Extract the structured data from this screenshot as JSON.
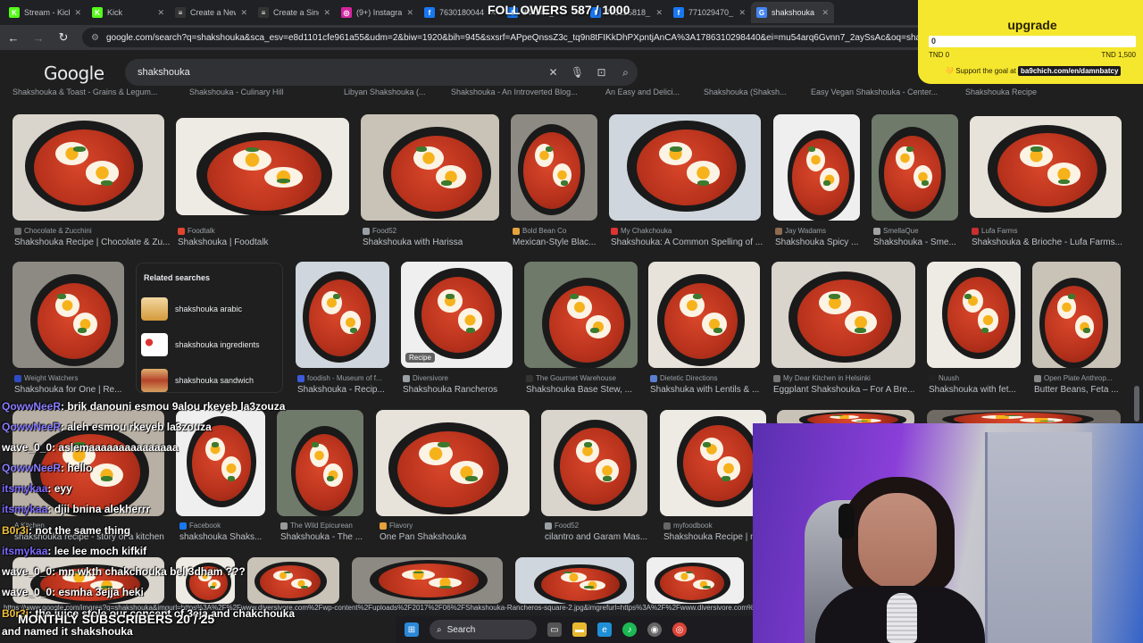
{
  "browser": {
    "tabs": [
      {
        "label": "Stream - Kick",
        "fav": "K",
        "color": "#53fc18"
      },
      {
        "label": "Kick",
        "fav": "K",
        "color": "#53fc18"
      },
      {
        "label": "Create a New",
        "fav": "≡",
        "color": "#333333"
      },
      {
        "label": "Create a Sing",
        "fav": "≡",
        "color": "#333333"
      },
      {
        "label": "(9+) Instagram",
        "fav": "◎",
        "color": "#d6249f"
      },
      {
        "label": "7630180044",
        "fav": "f",
        "color": "#1877f2"
      },
      {
        "label": "844247_",
        "fav": "f",
        "color": "#1877f2"
      },
      {
        "label": "763155818_",
        "fav": "f",
        "color": "#1877f2"
      },
      {
        "label": "771029470_",
        "fav": "f",
        "color": "#1877f2"
      },
      {
        "label": "shakshouka",
        "fav": "G",
        "color": "#4285f4"
      }
    ],
    "url": "google.com/search?q=shakshouka&sca_esv=e8d1101cfe961a55&udm=2&biw=1920&bih=945&sxsrf=APpeQnssZ3c_tq9n8tFIKkDhPXpntjAnCA%3A1786310298440&ei=mu54arq6Gvnn7_2aySsAc&oq=shaksho&gs_lp=Egt"
  },
  "google": {
    "logo": "Google",
    "query": "shakshouka",
    "captions_top": [
      "Shakshouka & Toast - Grains & Legum...",
      "Shakshouka - Culinary Hill",
      "Libyan Shakshouka (...",
      "Shakshouka - An Introverted Blog...",
      "An Easy and Delici...",
      "Shakshouka (Shaksh...",
      "Easy Vegan Shakshouka - Center...",
      "Shakshouka Recipe"
    ],
    "row1": [
      {
        "source": "Chocolate & Zucchini",
        "title": "Shakshouka Recipe | Chocolate & Zu...",
        "sfav": "#6d6d6d"
      },
      {
        "source": "Foodtalk",
        "title": "Shakshouka | Foodtalk",
        "sfav": "#e0462d"
      },
      {
        "source": "Food52",
        "title": "Shakshouka with Harissa",
        "sfav": "#9aa0a6"
      },
      {
        "source": "Bold Bean Co",
        "title": "Mexican-Style Blac...",
        "sfav": "#e8a23a"
      },
      {
        "source": "My Chakchouka",
        "title": "Shakshouka: A Common Spelling of ...",
        "sfav": "#d33"
      },
      {
        "source": "Jay Wadams",
        "title": "Shakshouka Spicy ...",
        "sfav": "#8c6b4f"
      },
      {
        "source": "SmellaQue",
        "title": "Shakshouka - Sme...",
        "sfav": "#a3a3a3"
      },
      {
        "source": "Lufa Farms",
        "title": "Shakshouka & Brioche - Lufa Farms...",
        "sfav": "#c92f2f"
      }
    ],
    "related": {
      "title": "Related searches",
      "items": [
        "shakshouka arabic",
        "shakshouka ingredients",
        "shakshouka sandwich"
      ]
    },
    "row2": [
      {
        "source": "Weight Watchers",
        "title": "Shakshouka for One | Re...",
        "sfav": "#2e4cc4"
      },
      {
        "source": "foodish - Museum of f...",
        "title": "Shakshouka - Recip...",
        "sfav": "#3b5bdb"
      },
      {
        "source": "Diversivore",
        "title": "Shakshouka Rancheros",
        "sfav": "#9aa0a6"
      },
      {
        "source": "The Gourmet Warehouse",
        "title": "Shakshouka Base Stew, ...",
        "sfav": "#333"
      },
      {
        "source": "Dietetic Directions",
        "title": "Shakshuka with Lentils & ...",
        "sfav": "#5b7fd1"
      },
      {
        "source": "My Dear Kitchen in Helsinki",
        "title": "Eggplant Shakshouka – For A Bre...",
        "sfav": "#777"
      },
      {
        "source": "Nuush",
        "title": "Shakshouka with fet...",
        "sfav": "#222"
      },
      {
        "source": "Open Plate Anthrop...",
        "title": "Butter Beans, Feta ...",
        "sfav": "#888"
      }
    ],
    "row2_badge": "Recipe",
    "row3": [
      {
        "source": "Facebook",
        "title": "shakshouka Shaks...",
        "sfav": "#1877f2"
      },
      {
        "source": "The Wild Epicurean",
        "title": "Shakshouka - The ...",
        "sfav": "#999"
      },
      {
        "source": "Flavory",
        "title": "One Pan Shakshouka",
        "sfav": "#e5a13b"
      },
      {
        "source": "Food52",
        "title": "cilantro and Garam Mas...",
        "sfav": "#9aa0a6"
      },
      {
        "source": "myfoodbook",
        "title": "Shakshouka Recipe | m",
        "sfav": "#666"
      }
    ],
    "row3_hidden": {
      "source": "A Kitchen",
      "title": "shakshouka recipe - story of a kitchen"
    },
    "status_url": "https://www.google.com/imgres?q=shakshouka&imgurl=https%3A%2F%2Fwww.diversivore.com%2Fwp-content%2Fuploads%2F2017%2F06%2FShakshouka-Rancheros-square-2.jpg&imgrefurl=https%3A%2F%2Fwww.diversivore.com%2Fshakshouka-rancheros%2F&docid=..."
  },
  "stream": {
    "followers": "FOLLOWERS 587 / 1000",
    "upgrade": {
      "title": "upgrade",
      "progress": "0",
      "progress_fraction": 0,
      "min": "TND 0",
      "max": "TND 1,500",
      "goal_text": "Support the goal at",
      "goal_link": "ba9chich.com/en/damnbatcy"
    },
    "subscribers": "MONTHLY SUBSCRIBERS 20 / 25",
    "chat": [
      {
        "user": "QowwNeeR",
        "msg": ": brik danouni esmou 9alou rkeyeb la3zouza",
        "color": "#8a7dff"
      },
      {
        "user": "QowwNeeR",
        "msg": ": aleh esmou rkeyeb la3zouza",
        "color": "#8a7dff"
      },
      {
        "user": "wave_0_0",
        "msg": ": aslemaaaaaaaaaaaaaaa",
        "color": "#ffffff"
      },
      {
        "user": "QowwNeeR",
        "msg": ": hello",
        "color": "#8a7dff"
      },
      {
        "user": "itsmykaa",
        "msg": ": eyy",
        "color": "#7d6bff"
      },
      {
        "user": "itsmykaa",
        "msg": ": djii bnina alekherrr",
        "color": "#7d6bff"
      },
      {
        "user": "B0r3i",
        "msg": ": not the same thing",
        "color": "#f0c040"
      },
      {
        "user": "itsmykaa",
        "msg": ": lee lee moch kifkif",
        "color": "#7d6bff"
      },
      {
        "user": "wave_0_0",
        "msg": ": mn wkth chakchouka bel 3dham ???",
        "color": "#ffffff"
      },
      {
        "user": "wave_0_0",
        "msg": ": esmha 3ejja heki",
        "color": "#ffffff"
      },
      {
        "user": "B0r3i",
        "msg": ": the juice stole our concept of 3eja and chakchouka",
        "color": "#f0c040"
      },
      {
        "user": "",
        "msg": "and named it shakshouka",
        "color": "#ffffff"
      }
    ]
  },
  "taskbar": {
    "search_label": "Search"
  }
}
